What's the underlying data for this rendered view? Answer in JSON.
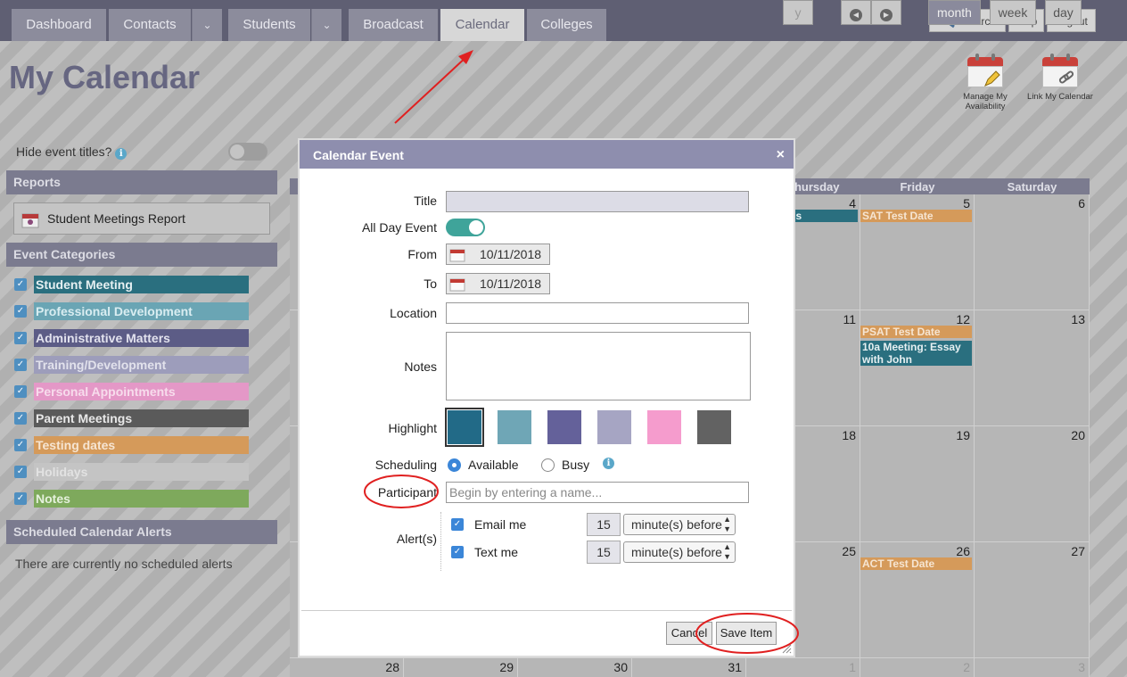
{
  "nav": {
    "tabs": [
      "Dashboard",
      "Contacts",
      "Students",
      "Broadcast",
      "Calendar",
      "Colleges"
    ],
    "active_tab": "Calendar",
    "search": "Search",
    "help": "Help",
    "logout": "Logout"
  },
  "page": {
    "title": "My Calendar",
    "manage_availability": "Manage My Availability",
    "link_calendar": "Link My Calendar"
  },
  "sidebar": {
    "hide_titles": "Hide event titles?",
    "reports_header": "Reports",
    "report_button": "Student Meetings Report",
    "categories_header": "Event Categories",
    "categories": [
      {
        "label": "Student Meeting",
        "color": "#2a6f7f",
        "text": "#e6f0f2"
      },
      {
        "label": "Professional Development",
        "color": "#6aa5b4",
        "text": "#d9edf1"
      },
      {
        "label": "Administrative Matters",
        "color": "#5c5c86",
        "text": "#e2e2ee"
      },
      {
        "label": "Training/Development",
        "color": "#9d9dbb",
        "text": "#e2e2ec"
      },
      {
        "label": "Personal Appointments",
        "color": "#e498c7",
        "text": "#f7dcec"
      },
      {
        "label": "Parent Meetings",
        "color": "#5a5a5a",
        "text": "#e8e8e8"
      },
      {
        "label": "Testing dates",
        "color": "#d59a5a",
        "text": "#f6e5d2"
      },
      {
        "label": "Holidays",
        "color": "#c4c4c4",
        "text": "#e2e2e2"
      },
      {
        "label": "Notes",
        "color": "#7ea95c",
        "text": "#e5f1dc"
      }
    ],
    "alerts_header": "Scheduled Calendar Alerts",
    "no_alerts": "There are currently no scheduled alerts"
  },
  "calendar": {
    "view_buttons": [
      "month",
      "week",
      "day"
    ],
    "active_view": "month",
    "partial_label": "y",
    "days_of_week": [
      "Thursday",
      "Friday",
      "Saturday"
    ],
    "rows": [
      {
        "nums": [
          "4",
          "5",
          "6"
        ],
        "events": {
          "1": [
            {
              "text": "SAT Test Date",
              "cat": 6
            }
          ],
          "0": [
            {
              "text": "rch Kelly's",
              "cat": 0
            }
          ]
        }
      },
      {
        "nums": [
          "11",
          "12",
          "13"
        ],
        "events": {
          "1": [
            {
              "text": "PSAT Test Date",
              "cat": 6
            },
            {
              "text": "10a  Meeting: Essay with John",
              "cat": 0
            }
          ]
        }
      },
      {
        "nums": [
          "18",
          "19",
          "20"
        ],
        "events": {}
      },
      {
        "nums": [
          "25",
          "26",
          "27"
        ],
        "events": {
          "1": [
            {
              "text": "ACT Test Date",
              "cat": 6
            }
          ]
        }
      }
    ],
    "bottom_row": {
      "nums": [
        "28",
        "29",
        "30",
        "31",
        "1",
        "2",
        "3"
      ]
    }
  },
  "modal": {
    "title": "Calendar Event",
    "close": "×",
    "labels": {
      "title": "Title",
      "all_day": "All Day Event",
      "from": "From",
      "to": "To",
      "location": "Location",
      "notes": "Notes",
      "highlight": "Highlight",
      "scheduling": "Scheduling",
      "participant": "Participant",
      "alerts": "Alert(s)"
    },
    "title_value": "",
    "location_value": "",
    "notes_value": "",
    "all_day_on": true,
    "from_date": "10/11/2018",
    "to_date": "10/11/2018",
    "highlight_colors": [
      "#226a87",
      "#6fa6b6",
      "#64619a",
      "#a6a5c3",
      "#f59ccd",
      "#626262"
    ],
    "scheduling": {
      "available": "Available",
      "busy": "Busy",
      "selected": "Available"
    },
    "participant_placeholder": "Begin by entering a name...",
    "alerts": [
      {
        "label": "Email me",
        "checked": true,
        "amount": "15",
        "unit": "minute(s) before"
      },
      {
        "label": "Text me",
        "checked": true,
        "amount": "15",
        "unit": "minute(s) before"
      }
    ],
    "cancel": "Cancel",
    "save": "Save Item"
  },
  "annotations": {
    "arrow_color": "#e02020",
    "circle_color": "#e02020"
  }
}
